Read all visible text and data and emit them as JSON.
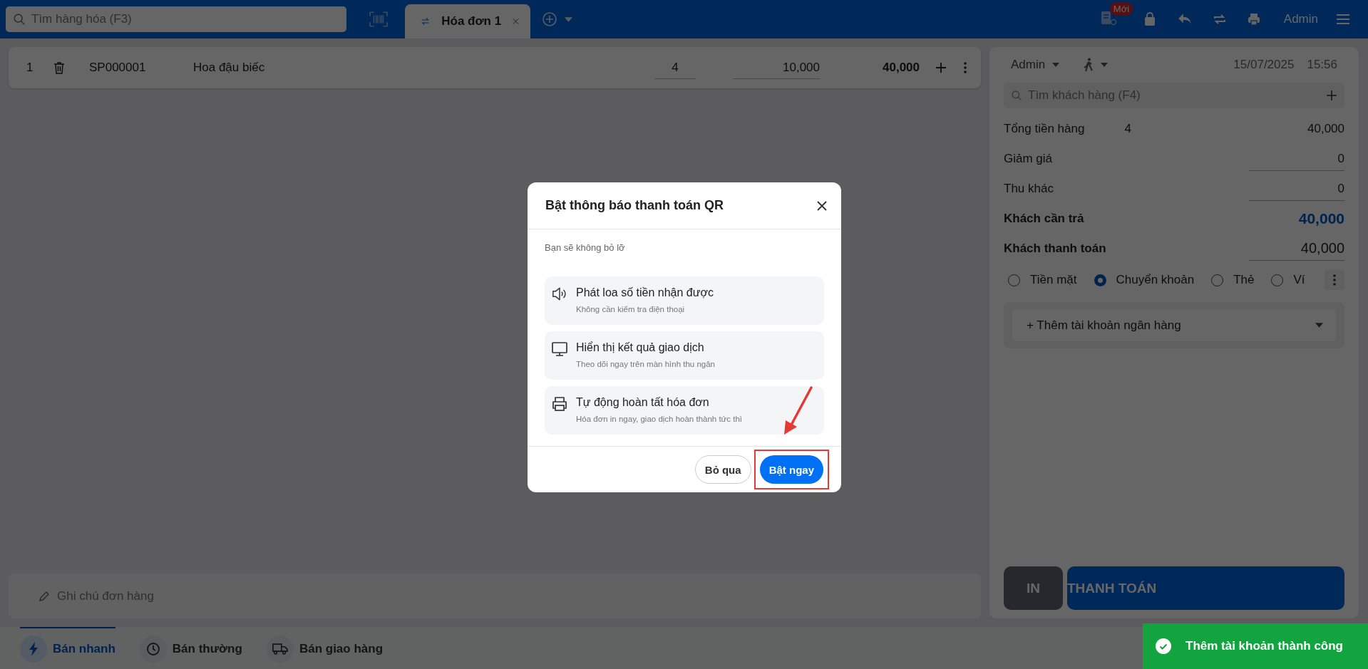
{
  "top_bar": {
    "search": {
      "placeholder": "Tìm hàng hóa (F3)"
    },
    "tabs": [
      {
        "label": "Hóa đơn 1",
        "selected": true
      }
    ],
    "badge": "Mới",
    "user": "Admin"
  },
  "order_lines": [
    {
      "index": "1",
      "code": "SP000001",
      "name": "Hoa đậu biếc",
      "quantity": "4",
      "price": "10,000",
      "total": "40,000"
    }
  ],
  "note": {
    "placeholder": "Ghi chú đơn hàng"
  },
  "sale_modes": [
    {
      "label": "Bán nhanh",
      "selected": true,
      "kind": "bolt"
    },
    {
      "label": "Bán thường",
      "selected": false,
      "kind": "clock"
    },
    {
      "label": "Bán giao hàng",
      "selected": false,
      "kind": "truck"
    }
  ],
  "checkout": {
    "staff": "Admin",
    "date": "15/07/2025",
    "time": "15:56",
    "customer_search": {
      "placeholder": "Tìm khách hàng (F4)"
    },
    "summary": [
      {
        "label": "Tổng tiền hàng",
        "count": "4",
        "value": "40,000",
        "kind": "plain"
      },
      {
        "label": "Giảm giá",
        "value": "0",
        "kind": "input"
      },
      {
        "label": "Thu khác",
        "value": "0",
        "kind": "input"
      },
      {
        "label": "Khách cần trả",
        "value": "40,000",
        "kind": "due"
      },
      {
        "label": "Khách thanh toán",
        "value": "40,000",
        "kind": "paid"
      }
    ],
    "payment_methods": [
      {
        "label": "Tiền mặt",
        "selected": false
      },
      {
        "label": "Chuyển khoản",
        "selected": true
      },
      {
        "label": "Thẻ",
        "selected": false
      },
      {
        "label": "Ví",
        "selected": false
      }
    ],
    "bank_account": "+ Thêm tài khoản ngân hàng",
    "buttons": [
      {
        "label": "IN",
        "kind": "print"
      },
      {
        "label": "THANH TOÁN",
        "kind": "pay"
      }
    ]
  },
  "modal": {
    "title": "Bật thông báo thanh toán QR",
    "subtitle": "Bạn sẽ không bỏ lỡ",
    "features": [
      {
        "kind": "speaker",
        "title": "Phát loa số tiền nhận được",
        "description": "Không cần kiểm tra điện thoại"
      },
      {
        "kind": "monitor",
        "title": "Hiển thị kết quả giao dịch",
        "description": "Theo dõi ngay trên màn hình thu ngân"
      },
      {
        "kind": "printer",
        "title": "Tự động hoàn tất hóa đơn",
        "description": "Hóa đơn in ngay, giao dịch hoàn thành tức thì"
      }
    ],
    "buttons": [
      {
        "label": "Bỏ qua",
        "kind": "secondary"
      },
      {
        "label": "Bật ngay",
        "kind": "primary"
      }
    ]
  },
  "toast": {
    "message": "Thêm tài khoản thành công"
  }
}
